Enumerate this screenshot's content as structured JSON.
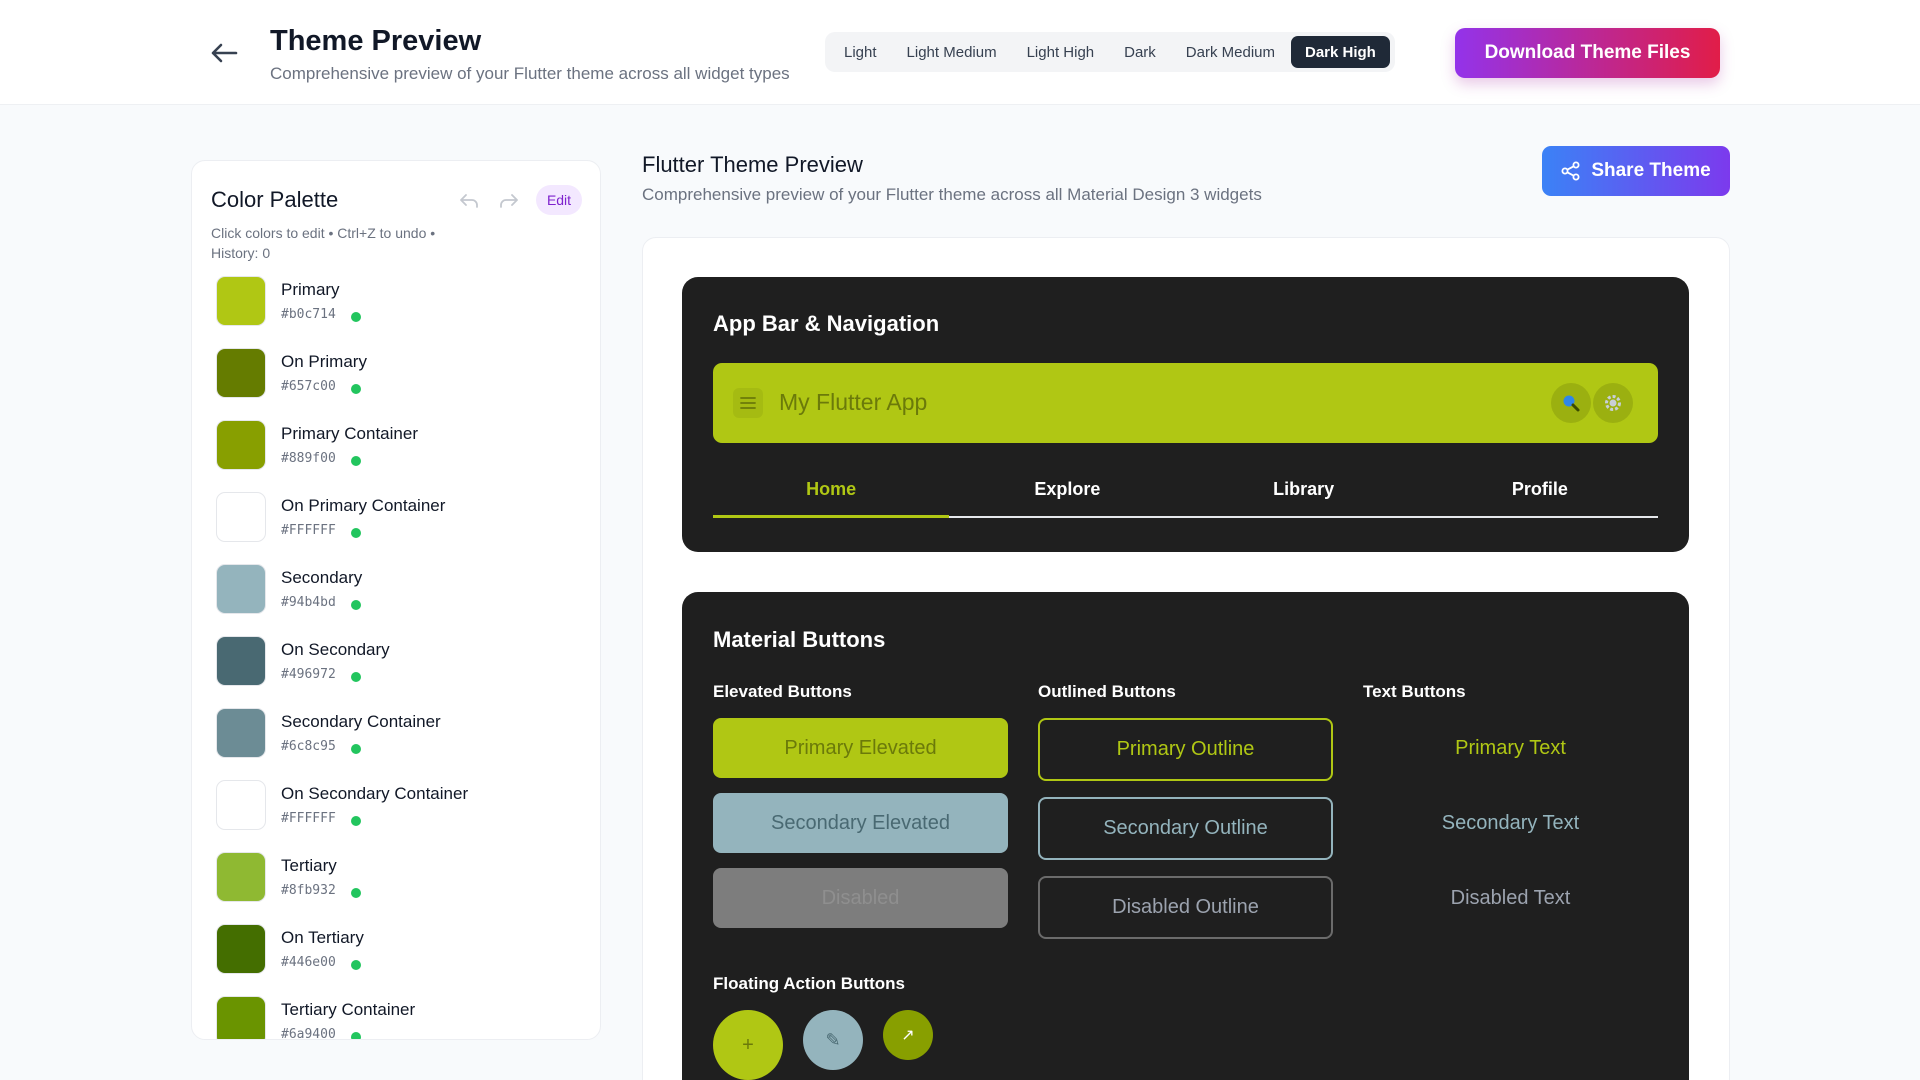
{
  "header": {
    "title": "Theme Preview",
    "subtitle": "Comprehensive preview of your Flutter theme across all widget types",
    "modes": [
      "Light",
      "Light Medium",
      "Light High",
      "Dark",
      "Dark Medium",
      "Dark High"
    ],
    "active_mode": "Dark High",
    "download_label": "Download Theme Files"
  },
  "sidebar": {
    "title": "Color Palette",
    "edit_label": "Edit",
    "hint": "Click colors to edit • Ctrl+Z to undo • History: 0",
    "colors": [
      {
        "name": "Primary",
        "hex": "#b0c714"
      },
      {
        "name": "On Primary",
        "hex": "#657c00"
      },
      {
        "name": "Primary Container",
        "hex": "#889f00"
      },
      {
        "name": "On Primary Container",
        "hex": "#FFFFFF"
      },
      {
        "name": "Secondary",
        "hex": "#94b4bd"
      },
      {
        "name": "On Secondary",
        "hex": "#496972"
      },
      {
        "name": "Secondary Container",
        "hex": "#6c8c95"
      },
      {
        "name": "On Secondary Container",
        "hex": "#FFFFFF"
      },
      {
        "name": "Tertiary",
        "hex": "#8fb932"
      },
      {
        "name": "On Tertiary",
        "hex": "#446e00"
      },
      {
        "name": "Tertiary Container",
        "hex": "#6a9400"
      }
    ]
  },
  "main": {
    "title": "Flutter Theme Preview",
    "subtitle": "Comprehensive preview of your Flutter theme across all Material Design 3 widgets",
    "share_label": "Share Theme"
  },
  "appbar_card": {
    "title": "App Bar & Navigation",
    "app_title": "My Flutter App",
    "tabs": [
      "Home",
      "Explore",
      "Library",
      "Profile"
    ]
  },
  "buttons_card": {
    "title": "Material Buttons",
    "elevated_head": "Elevated Buttons",
    "outlined_head": "Outlined Buttons",
    "text_head": "Text Buttons",
    "elevated": [
      "Primary Elevated",
      "Secondary Elevated",
      "Disabled"
    ],
    "outlined": [
      "Primary Outline",
      "Secondary Outline",
      "Disabled Outline"
    ],
    "text": [
      "Primary Text",
      "Secondary Text",
      "Disabled Text"
    ],
    "fab_head": "Floating Action Buttons",
    "fabs": [
      "+",
      "✎",
      "↗"
    ]
  },
  "theme_colors": {
    "primary": "#b0c714",
    "secondary": "#94b4bd",
    "tertiary": "#8fb932",
    "card_bg": "#1f1f1f",
    "accent_gradient": [
      "#9333ea",
      "#e11d48"
    ],
    "share_gradient": [
      "#3b82f6",
      "#7c3aed"
    ]
  }
}
